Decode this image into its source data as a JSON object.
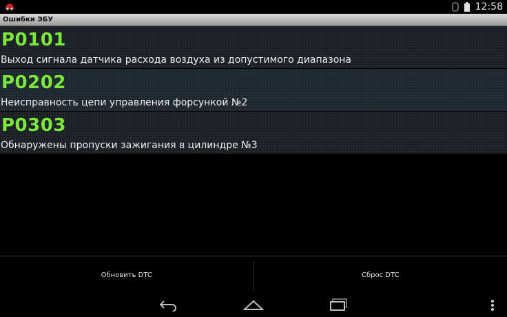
{
  "status_bar": {
    "time": "12:58",
    "icons": [
      "notification-app-icon",
      "bluetooth-icon",
      "battery-icon"
    ]
  },
  "title_bar": {
    "title": "Ошибки ЭБУ"
  },
  "dtc_list": [
    {
      "code": "P0101",
      "description": "Выход сигнала датчика расхода воздуха из допустимого диапазона"
    },
    {
      "code": "P0202",
      "description": "Неисправность цепи управления форсункой №2"
    },
    {
      "code": "P0303",
      "description": "Обнаружены пропуски зажигания в цилиндре №3"
    }
  ],
  "actions": {
    "refresh_label": "Обновить DTC",
    "reset_label": "Сброс DTC"
  },
  "nav_bar": {
    "icons": [
      "back-icon",
      "home-icon",
      "recent-apps-icon",
      "overflow-menu-icon"
    ]
  },
  "colors": {
    "code_green": "#7be73a",
    "row_bg": "#1a2025",
    "title_bar_top": "#d9d9d9",
    "title_bar_bottom": "#9c9c9c"
  }
}
